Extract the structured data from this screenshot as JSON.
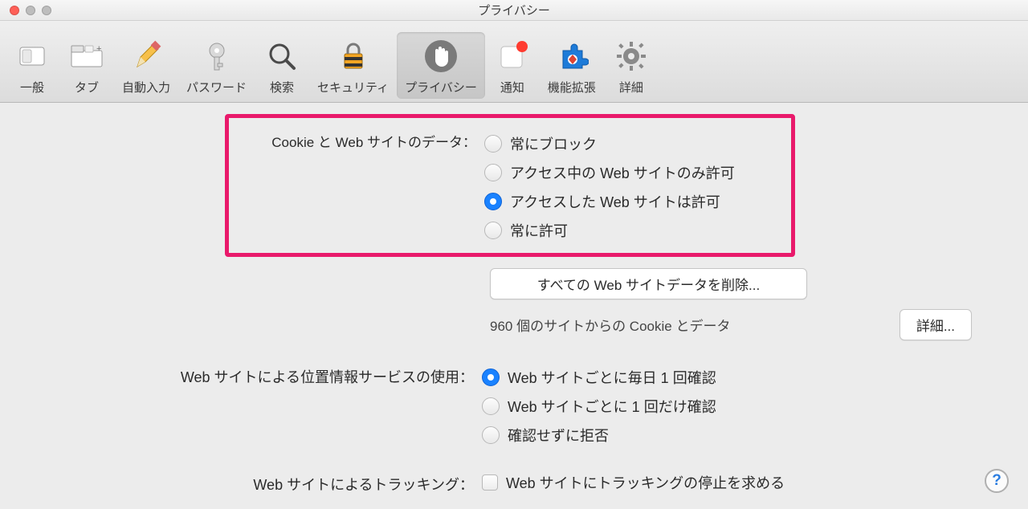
{
  "window": {
    "title": "プライバシー"
  },
  "toolbar": {
    "items": [
      {
        "label": "一般",
        "icon": "switch-icon",
        "active": false
      },
      {
        "label": "タブ",
        "icon": "tabs-icon",
        "active": false
      },
      {
        "label": "自動入力",
        "icon": "pencil-icon",
        "active": false
      },
      {
        "label": "パスワード",
        "icon": "key-icon",
        "active": false
      },
      {
        "label": "検索",
        "icon": "search-icon",
        "active": false
      },
      {
        "label": "セキュリティ",
        "icon": "lock-icon",
        "active": false
      },
      {
        "label": "プライバシー",
        "icon": "hand-icon",
        "active": true
      },
      {
        "label": "通知",
        "icon": "bell-dot-icon",
        "active": false
      },
      {
        "label": "機能拡張",
        "icon": "puzzle-icon",
        "active": false
      },
      {
        "label": "詳細",
        "icon": "gear-icon",
        "active": false
      }
    ]
  },
  "cookies": {
    "label": "Cookie と Web サイトのデータ：",
    "options": [
      {
        "text": "常にブロック",
        "checked": false
      },
      {
        "text": "アクセス中の Web サイトのみ許可",
        "checked": false
      },
      {
        "text": "アクセスした Web サイトは許可",
        "checked": true
      },
      {
        "text": "常に許可",
        "checked": false
      }
    ],
    "remove_button": "すべての Web サイトデータを削除...",
    "status": "960 個のサイトからの Cookie とデータ",
    "details_button": "詳細..."
  },
  "location": {
    "label": "Web サイトによる位置情報サービスの使用：",
    "options": [
      {
        "text": "Web サイトごとに毎日 1 回確認",
        "checked": true
      },
      {
        "text": "Web サイトごとに 1 回だけ確認",
        "checked": false
      },
      {
        "text": "確認せずに拒否",
        "checked": false
      }
    ]
  },
  "tracking": {
    "label": "Web サイトによるトラッキング：",
    "checkbox_text": "Web サイトにトラッキングの停止を求める",
    "checked": false
  },
  "help": "?"
}
